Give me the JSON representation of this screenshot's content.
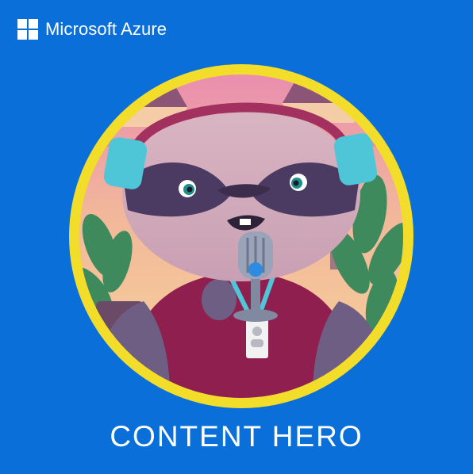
{
  "brand": {
    "name": "Microsoft Azure",
    "logo_icon": "microsoft-four-squares-icon"
  },
  "badge": {
    "illustration": "raccoon-mascot-with-headphones-and-microphone",
    "ring_color": "#f3dd2b",
    "background_color": "#0a6fd9"
  },
  "footer": {
    "title": "CONTENT HERO"
  }
}
